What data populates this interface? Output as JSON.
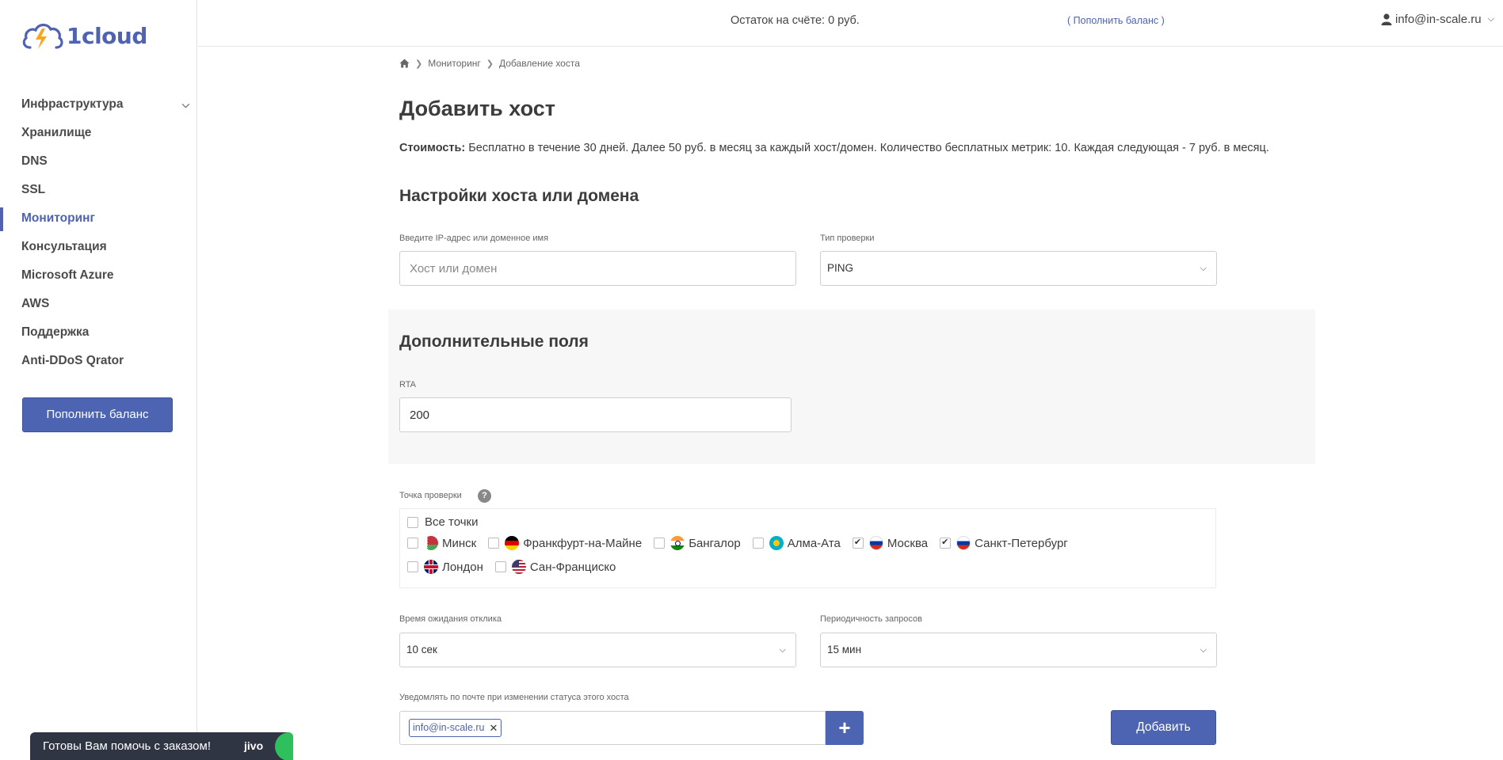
{
  "logo": {
    "text": "1cloud"
  },
  "header": {
    "balance": "Остаток на счёте: 0 руб.",
    "topup_link": "( Пополнить баланс )",
    "account": "info@in-scale.ru"
  },
  "sidebar": {
    "items": [
      {
        "label": "Инфраструктура",
        "has_submenu": true
      },
      {
        "label": "Хранилище"
      },
      {
        "label": "DNS"
      },
      {
        "label": "SSL"
      },
      {
        "label": "Мониторинг",
        "active": true
      },
      {
        "label": "Консультация"
      },
      {
        "label": "Microsoft Azure"
      },
      {
        "label": "AWS"
      },
      {
        "label": "Поддержка"
      },
      {
        "label": "Anti-DDoS Qrator"
      }
    ],
    "topup_button": "Пополнить баланс"
  },
  "breadcrumb": {
    "items": [
      "Мониторинг",
      "Добавление хоста"
    ]
  },
  "page": {
    "title": "Добавить хост",
    "cost_label": "Стоимость:",
    "cost_text": " Бесплатно в течение 30 дней. Далее 50 руб. в месяц за каждый хост/домен. Количество бесплатных метрик: 10. Каждая следующая - 7 руб. в месяц."
  },
  "host_settings": {
    "title": "Настройки хоста или домена",
    "host_label": "Введите IP-адрес или доменное имя",
    "host_placeholder": "Хост или домен",
    "host_value": "",
    "check_type_label": "Тип проверки",
    "check_type_value": "PING"
  },
  "extra_fields": {
    "title": "Дополнительные поля",
    "rta_label": "RTA",
    "rta_value": "200"
  },
  "check_points": {
    "label": "Точка проверки",
    "help": "?",
    "all_label": "Все точки",
    "all_checked": false,
    "points": [
      {
        "label": "Минск",
        "flag": "belarus",
        "checked": false
      },
      {
        "label": "Франкфурт-на-Майне",
        "flag": "germany",
        "checked": false
      },
      {
        "label": "Бангалор",
        "flag": "india",
        "checked": false
      },
      {
        "label": "Алма-Ата",
        "flag": "kazakhstan",
        "checked": false
      },
      {
        "label": "Москва",
        "flag": "russia",
        "checked": true
      },
      {
        "label": "Санкт-Петербург",
        "flag": "russia",
        "checked": true
      },
      {
        "label": "Лондон",
        "flag": "uk",
        "checked": false
      },
      {
        "label": "Сан-Франциско",
        "flag": "usa",
        "checked": false
      }
    ]
  },
  "timing": {
    "timeout_label": "Время ожидания отклика",
    "timeout_value": "10 сек",
    "interval_label": "Периодичность запросов",
    "interval_value": "15 мин"
  },
  "notify": {
    "label": "Уведомлять по почте при изменении статуса этого хоста",
    "emails": [
      "info@in-scale.ru"
    ],
    "add_symbol": "+",
    "submit_button": "Добавить"
  },
  "chat": {
    "text": "Готовы Вам помочь с заказом!",
    "brand": "jivo"
  },
  "colors": {
    "accent": "#4d64b2",
    "sidebar_active": "#4f63b1",
    "extra_box_bg": "#f7f7f7",
    "chat_bg": "#2f3542",
    "chat_dot": "#2ec05c"
  }
}
